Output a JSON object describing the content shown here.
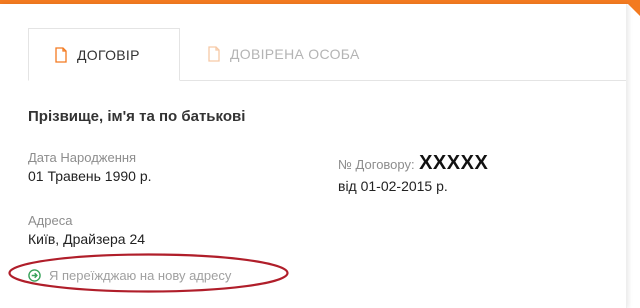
{
  "tabs": [
    {
      "label": "ДОГОВІР",
      "icon": "document-icon",
      "active": true
    },
    {
      "label": "ДОВІРЕНА ОСОБА",
      "icon": "document-icon",
      "active": false
    }
  ],
  "client": {
    "full_name": "Прізвище, ім'я та по батькові",
    "birth_date_label": "Дата Народження",
    "birth_date": "01 Травень 1990 р.",
    "address_label": "Адреса",
    "address": "Київ, Драйзера 24"
  },
  "contract": {
    "number_label": "№ Договору:",
    "number": "XXXXX",
    "date": "від 01-02-2015 р."
  },
  "move_link": {
    "label": "Я переїжджаю на нову адресу",
    "icon": "arrow-right-circle-icon"
  },
  "colors": {
    "accent": "#f37a20",
    "link_icon": "#3aa35c",
    "highlight_ellipse": "#b01e2a"
  }
}
